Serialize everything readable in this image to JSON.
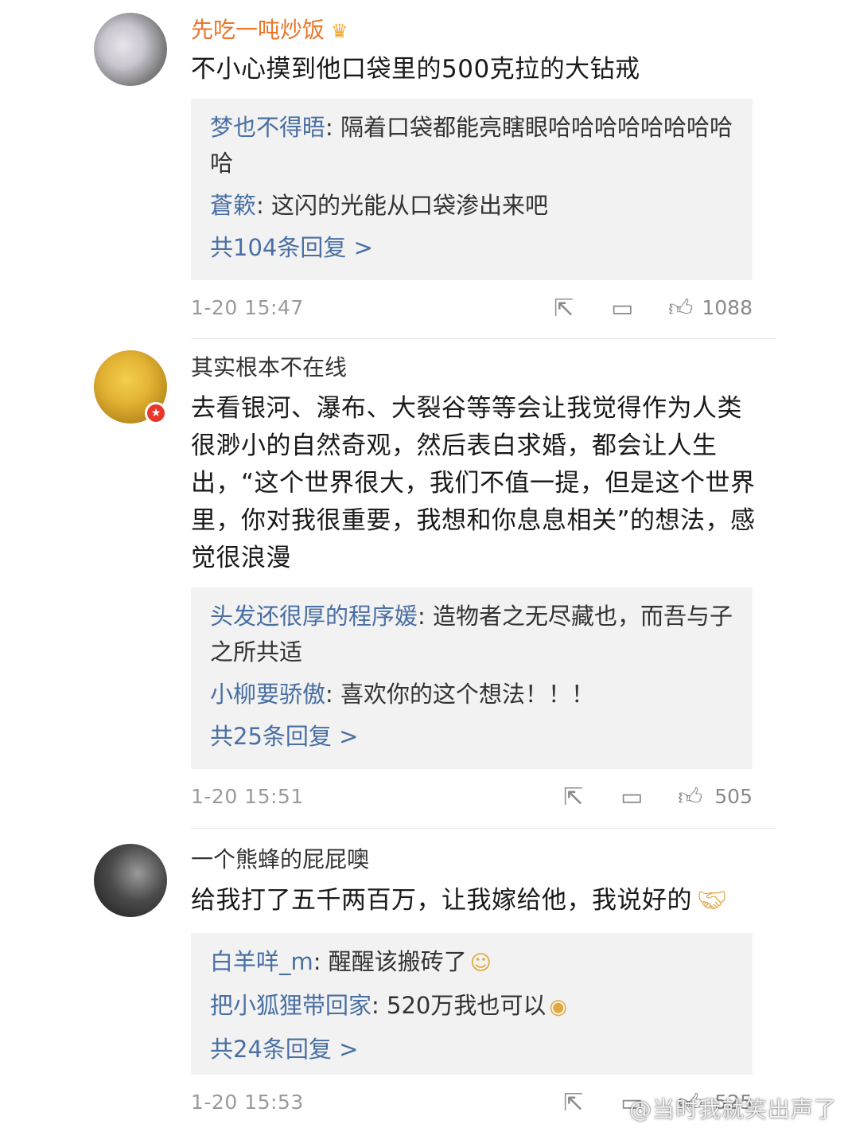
{
  "comments": [
    {
      "username": "先吃一吨炒饭",
      "text": "不小心摸到他口袋里的500克拉的大钻戒",
      "replies": [
        {
          "name": "梦也不得晤",
          "text": ": 隔着口袋都能亮瞎眼哈哈哈哈哈哈哈哈哈"
        },
        {
          "name": "蒼簌",
          "text": ": 这闪的光能从口袋渗出来吧"
        }
      ],
      "more_replies": "共104条回复 >",
      "time": "1-20 15:47",
      "likes": "1088"
    },
    {
      "username": "其实根本不在线",
      "text": "去看银河、瀑布、大裂谷等等会让我觉得作为人类很渺小的自然奇观，然后表白求婚，都会让人生出，“这个世界很大，我们不值一提，但是这个世界里，你对我很重要，我想和你息息相关”的想法，感觉很浪漫",
      "replies": [
        {
          "name": "头发还很厚的程序媛",
          "text": ": 造物者之无尽藏也，而吾与子之所共适"
        },
        {
          "name": "小柳要骄傲",
          "text": ": 喜欢你的这个想法！！！"
        }
      ],
      "more_replies": "共25条回复 >",
      "time": "1-20 15:51",
      "likes": "505"
    },
    {
      "username": "一个熊蜂的屁屁噢",
      "text": "给我打了五千两百万，让我嫁给他，我说好的",
      "replies": [
        {
          "name": "白羊咩_m",
          "text": ": 醒醒该搬砖了"
        },
        {
          "name": "把小狐狸带回家",
          "text": ": 520万我也可以"
        }
      ],
      "more_replies": "共24条回复 >",
      "time": "1-20 15:53",
      "likes": "525"
    }
  ],
  "watermark": "@当时我就笑出声了",
  "icons": {
    "crown": "crown-icon",
    "share": "share-icon",
    "comment": "comment-icon",
    "like": "like-icon",
    "handshake": "handshake-emoji",
    "grin": "grin-emoji",
    "shocked": "shocked-emoji"
  },
  "colors": {
    "vip_name": "#e8762b",
    "reply_name": "#496fa3",
    "reply_bg": "#f2f2f2"
  }
}
